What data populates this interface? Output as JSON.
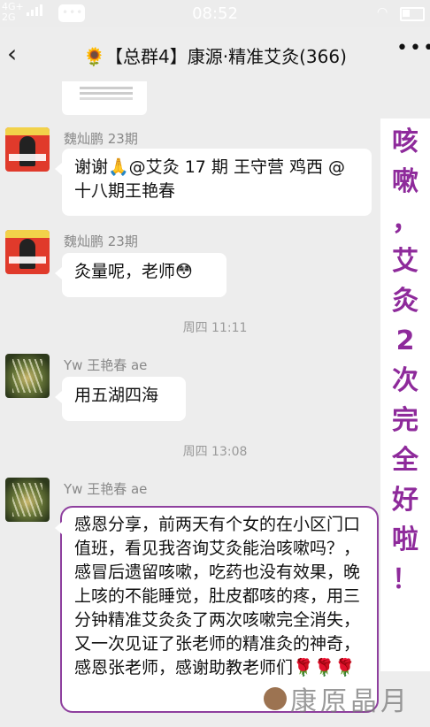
{
  "status_bar": {
    "signal_top": "4G+",
    "signal_bottom": "2G",
    "time": "08:52"
  },
  "header": {
    "back_icon": "chevron-left-icon",
    "title": "🌻【总群4】康源·精准艾灸(366)",
    "more_icon": "more-dots-icon"
  },
  "messages": [
    {
      "sender": "魏灿鹏 23期",
      "text": "谢谢🙏@艾灸 17 期 王守营 鸡西 @十八期王艳春"
    },
    {
      "sender": "魏灿鹏 23期",
      "text": "灸量呢，老师😳"
    },
    {
      "timestamp": "周四 11:11"
    },
    {
      "sender": "Yw 王艳春 ae",
      "text": "用五湖四海"
    },
    {
      "timestamp": "周四 13:08"
    },
    {
      "sender": "Yw 王艳春 ae",
      "text": "感恩分享，前两天有个女的在小区门口值班，看见我咨询艾灸能治咳嗽吗？，感冒后遗留咳嗽，吃药也没有效果，晚上咳的不能睡觉，肚皮都咳的疼，用三分钟精准艾灸灸了两次咳嗽完全消失，又一次见证了张老师的精准灸的神奇，感恩张老师，感谢助教老师们🌹🌹🌹"
    }
  ],
  "side_caption": [
    "咳",
    "嗽",
    "，",
    "艾",
    "灸",
    "2",
    "次",
    "完",
    "全",
    "好",
    "啦",
    "！"
  ],
  "watermark": "康原晶月",
  "colors": {
    "caption": "#8e2a9b",
    "frame": "#8e3f9e",
    "background": "#ededed"
  }
}
